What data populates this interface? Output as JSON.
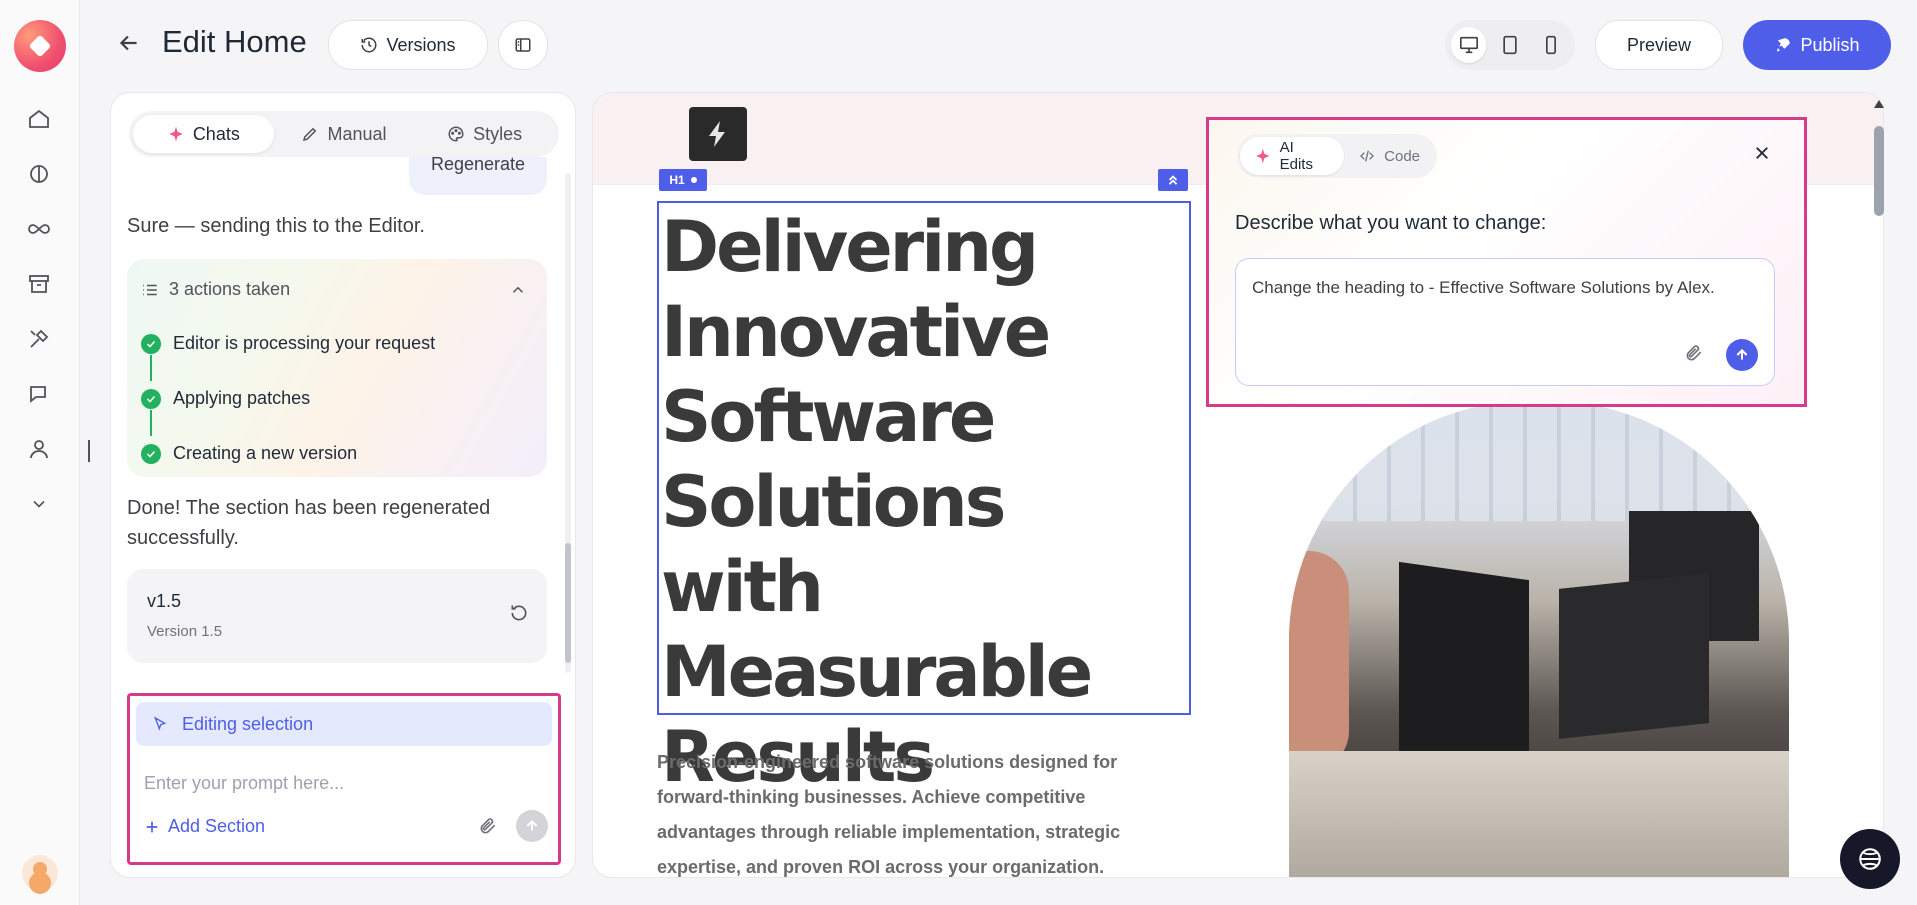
{
  "header": {
    "title": "Edit Home",
    "versions_label": "Versions",
    "preview_label": "Preview",
    "publish_label": "Publish"
  },
  "chat_panel": {
    "tabs": [
      {
        "label": "Chats",
        "icon": "sparkle-icon",
        "active": true
      },
      {
        "label": "Manual",
        "icon": "pencil-icon",
        "active": false
      },
      {
        "label": "Styles",
        "icon": "palette-icon",
        "active": false
      }
    ],
    "regenerate_label": "Regenerate",
    "message_1": "Sure — sending this to the Editor.",
    "actions": {
      "header": "3 actions taken",
      "steps": [
        "Editor is processing your request",
        "Applying patches",
        "Creating a new version"
      ]
    },
    "message_2": "Done! The section has been regenerated successfully.",
    "version": {
      "title": "v1.5",
      "subtitle": "Version 1.5"
    },
    "prompt": {
      "editing_selection": "Editing selection",
      "placeholder": "Enter your prompt here...",
      "add_section": "Add Section"
    }
  },
  "canvas": {
    "h1_tag": "H1",
    "heading_lines": [
      "Delivering",
      "Innovative",
      "Software",
      "Solutions with",
      "Measurable",
      "Results"
    ],
    "body_text": "Precision-engineered software solutions designed for forward-thinking businesses. Achieve competitive advantages through reliable implementation, strategic expertise, and proven ROI across your organization."
  },
  "ai_popover": {
    "tabs": [
      {
        "label": "AI Edits",
        "icon": "sparkle-icon",
        "active": true
      },
      {
        "label": "Code",
        "icon": "code-icon",
        "active": false
      }
    ],
    "label": "Describe what you want to change:",
    "input_value": "Change the heading to - Effective Software Solutions by Alex."
  },
  "colors": {
    "accent": "#4f5ee8",
    "highlight_border": "#d63a8a",
    "success": "#22b15e"
  }
}
